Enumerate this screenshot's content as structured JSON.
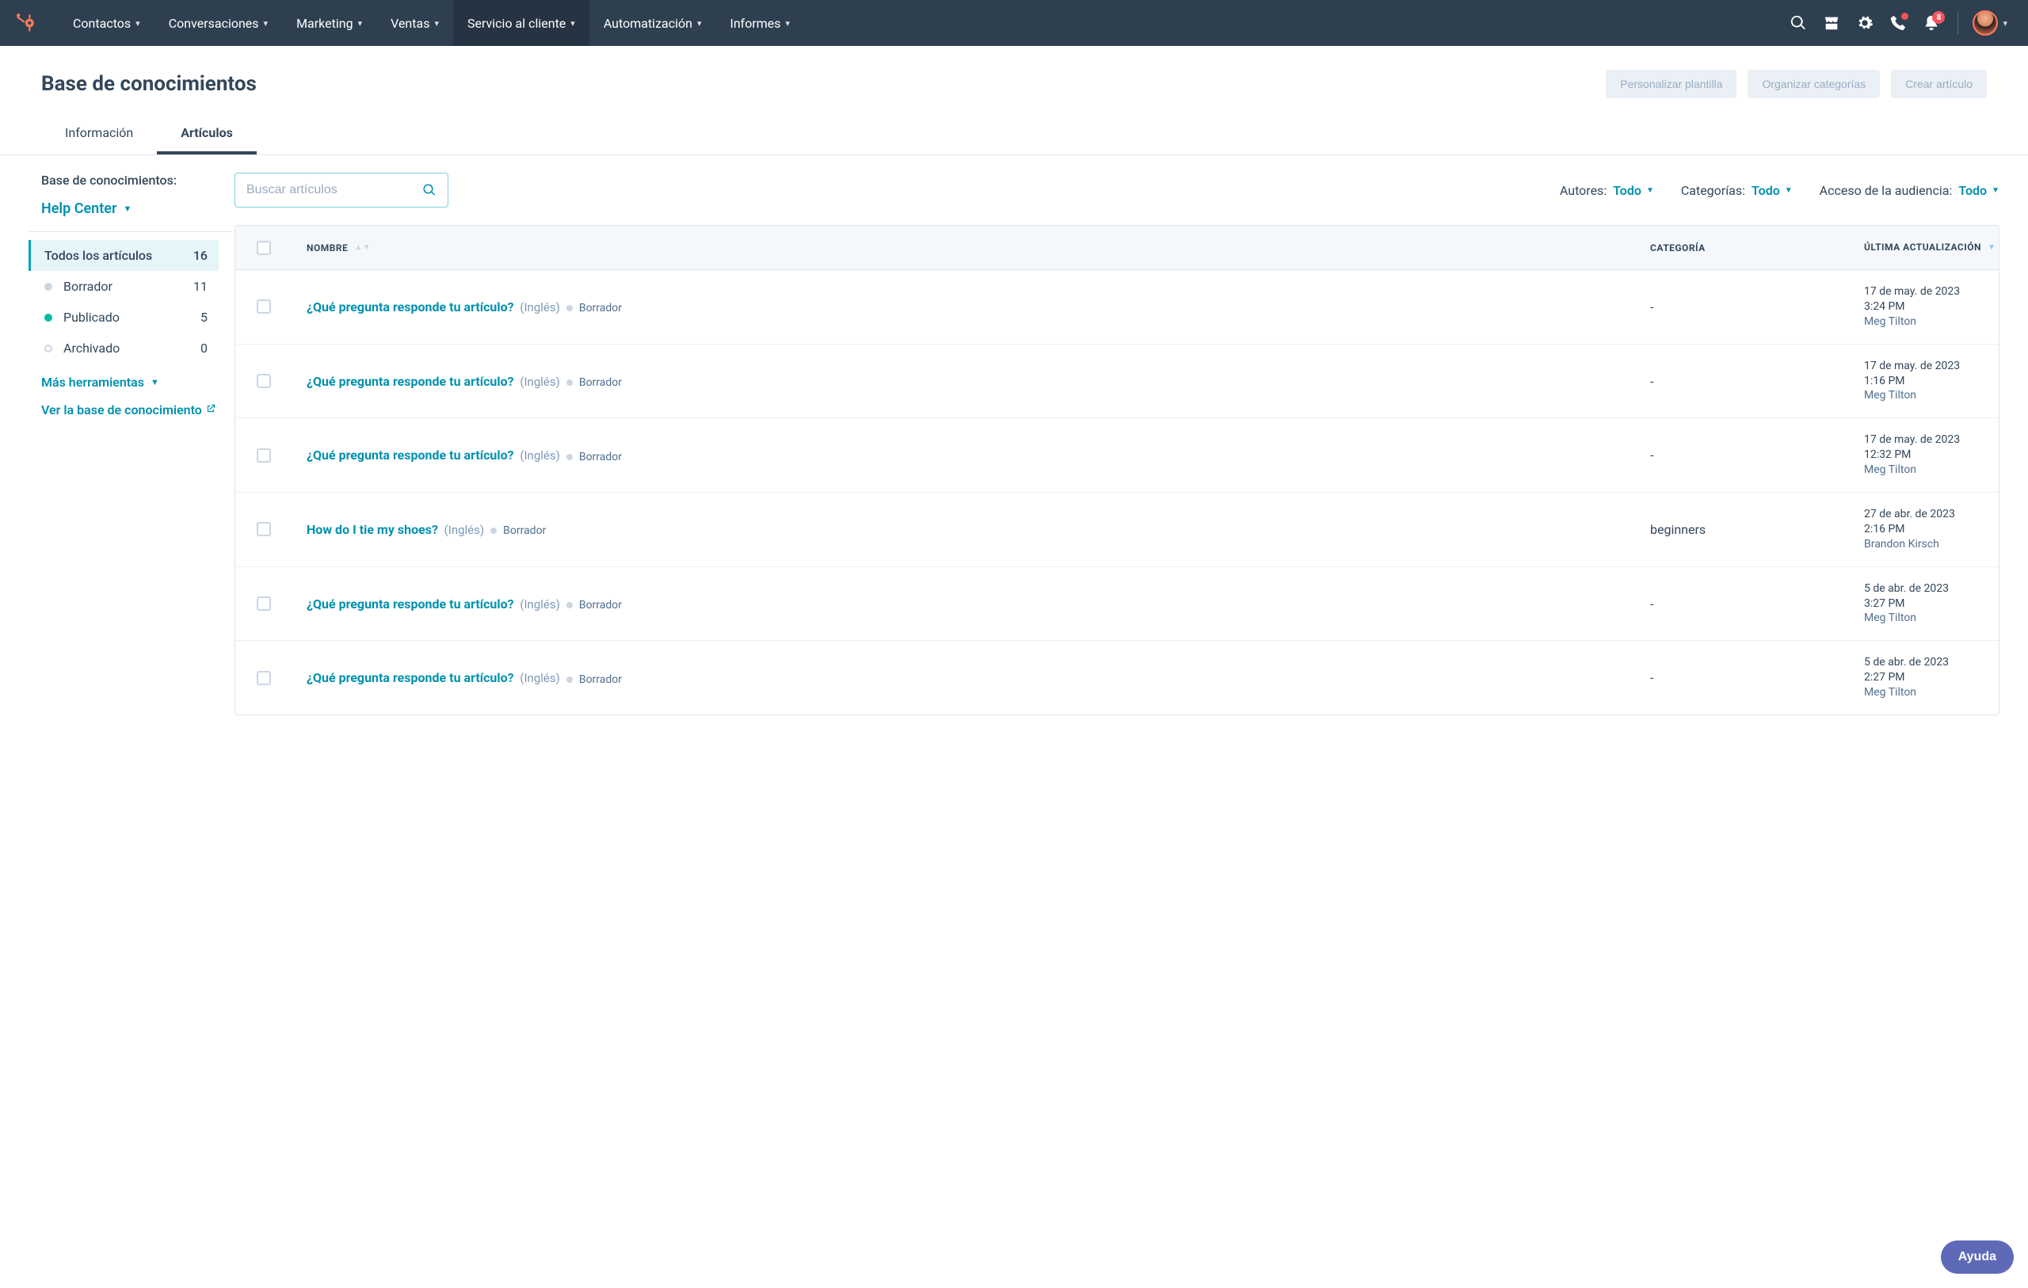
{
  "nav": {
    "items": [
      {
        "label": "Contactos"
      },
      {
        "label": "Conversaciones"
      },
      {
        "label": "Marketing"
      },
      {
        "label": "Ventas"
      },
      {
        "label": "Servicio al cliente",
        "active": true
      },
      {
        "label": "Automatización"
      },
      {
        "label": "Informes"
      }
    ],
    "notification_count": "8"
  },
  "page": {
    "title": "Base de conocimientos",
    "actions": {
      "customize": "Personalizar plantilla",
      "organize": "Organizar categorías",
      "create": "Crear artículo"
    },
    "tabs": [
      {
        "label": "Información",
        "active": false
      },
      {
        "label": "Artículos",
        "active": true
      }
    ]
  },
  "sidebar": {
    "kb_label": "Base de conocimientos:",
    "kb_selected": "Help Center",
    "items": [
      {
        "label": "Todos los artículos",
        "count": "16",
        "active": true,
        "dot": "none"
      },
      {
        "label": "Borrador",
        "count": "11",
        "dot": "gray"
      },
      {
        "label": "Publicado",
        "count": "5",
        "dot": "green"
      },
      {
        "label": "Archivado",
        "count": "0",
        "dot": "empty"
      }
    ],
    "more_tools": "Más herramientas",
    "view_kb": "Ver la base de conocimiento"
  },
  "filters": {
    "search_placeholder": "Buscar artículos",
    "authors_label": "Autores:",
    "authors_value": "Todo",
    "categories_label": "Categorías:",
    "categories_value": "Todo",
    "audience_label": "Acceso de la audiencia:",
    "audience_value": "Todo"
  },
  "table": {
    "headers": {
      "name": "Nombre",
      "category": "Categoría",
      "updated": "Última actualización"
    },
    "lang_label": "Inglés",
    "status_label": "Borrador",
    "rows": [
      {
        "title": "¿Qué pregunta responde tu artículo?",
        "category": "-",
        "date": "17 de may. de 2023",
        "time": "3:24 PM",
        "author": "Meg Tilton"
      },
      {
        "title": "¿Qué pregunta responde tu artículo?",
        "category": "-",
        "date": "17 de may. de 2023",
        "time": "1:16 PM",
        "author": "Meg Tilton"
      },
      {
        "title": "¿Qué pregunta responde tu artículo?",
        "category": "-",
        "date": "17 de may. de 2023",
        "time": "12:32 PM",
        "author": "Meg Tilton"
      },
      {
        "title": "How do I tie my shoes?",
        "category": "beginners",
        "date": "27 de abr. de 2023",
        "time": "2:16 PM",
        "author": "Brandon Kirsch"
      },
      {
        "title": "¿Qué pregunta responde tu artículo?",
        "category": "-",
        "date": "5 de abr. de 2023",
        "time": "3:27 PM",
        "author": "Meg Tilton"
      },
      {
        "title": "¿Qué pregunta responde tu artículo?",
        "category": "-",
        "date": "5 de abr. de 2023",
        "time": "2:27 PM",
        "author": "Meg Tilton"
      }
    ]
  },
  "help": "Ayuda"
}
